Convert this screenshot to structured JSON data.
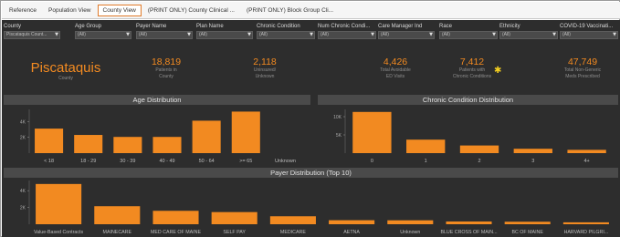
{
  "tabs": [
    {
      "label": "Reference",
      "active": false
    },
    {
      "label": "Population View",
      "active": false
    },
    {
      "label": "County View",
      "active": true
    },
    {
      "label": "(PRINT ONLY) County Clinical ...",
      "active": false
    },
    {
      "label": "(PRINT ONLY) Block Group Cli...",
      "active": false
    }
  ],
  "filters": [
    {
      "label": "County",
      "value": "Piscataquis Count..."
    },
    {
      "label": "Age Group",
      "value": "(All)"
    },
    {
      "label": "Payer Name",
      "value": "(All)"
    },
    {
      "label": "Plan Name",
      "value": "(All)"
    },
    {
      "label": "Chronic Condition",
      "value": "(All)"
    },
    {
      "label": "Num Chronic Condi...",
      "value": "(All)"
    },
    {
      "label": "Care Manager Ind",
      "value": "(All)"
    },
    {
      "label": "Race",
      "value": "(All)"
    },
    {
      "label": "Ethnicity",
      "value": "(All)"
    },
    {
      "label": "COVID-19 Vaccinati...",
      "value": "(All)"
    }
  ],
  "kpis": {
    "county": {
      "value": "Piscataquis",
      "label": "County"
    },
    "patients": {
      "value": "18,819",
      "label1": "Patients in",
      "label2": "County"
    },
    "uninsured": {
      "value": "2,118",
      "label1": "Uninsured/",
      "label2": "Unknown"
    },
    "ed_visits": {
      "value": "4,426",
      "label1": "Total Avoidable",
      "label2": "ED Visits"
    },
    "chronic": {
      "value": "7,412",
      "label1": "Patients with",
      "label2": "Chronic Conditions"
    },
    "meds": {
      "value": "47,749",
      "label1": "Total Non-Generic",
      "label2": "Meds Prescribed"
    }
  },
  "colors": {
    "bar": "#f28a21",
    "background": "#2d2d2d",
    "panel_title": "#4a4a4a",
    "star": "#f5d020"
  },
  "star_icon": "star-icon",
  "panels": {
    "age_title": "Age Distribution",
    "chronic_title": "Chronic Condition Distribution",
    "payer_title": "Payer Distribution (Top 10)"
  },
  "chart_data": [
    {
      "id": "age",
      "type": "bar",
      "title": "Age Distribution",
      "categories": [
        "< 18",
        "18 - 29",
        "30 - 39",
        "40 - 49",
        "50 - 64",
        ">= 65",
        "Unknown"
      ],
      "values": [
        3100,
        2300,
        2050,
        2050,
        4100,
        5250,
        0
      ],
      "yticks": [
        2000,
        4000
      ],
      "ytick_labels": [
        "2K",
        "4K"
      ],
      "ylim": [
        0,
        5300
      ],
      "grid": false
    },
    {
      "id": "chronic",
      "type": "bar",
      "title": "Chronic Condition Distribution",
      "categories": [
        "0",
        "1",
        "2",
        "3",
        "4+"
      ],
      "values": [
        11300,
        3700,
        2100,
        1200,
        900
      ],
      "yticks": [
        5000,
        10000
      ],
      "ytick_labels": [
        "5K",
        "10K"
      ],
      "ylim": [
        0,
        11500
      ],
      "grid": false
    },
    {
      "id": "payer",
      "type": "bar",
      "title": "Payer Distribution (Top 10)",
      "categories": [
        "Value-Based Contracts",
        "MAINECARE",
        "MED CARE OF MAINE",
        "SELF PAY",
        "MEDICARE",
        "AETNA",
        "Unknown",
        "BLUE CROSS OF MAIN...",
        "BC OF MAINE",
        "HARVARD PILGRI..."
      ],
      "values": [
        4800,
        2150,
        1600,
        1450,
        950,
        480,
        470,
        330,
        300,
        230
      ],
      "yticks": [
        2000,
        4000
      ],
      "ytick_labels": [
        "2K",
        "4K"
      ],
      "ylim": [
        0,
        5000
      ],
      "grid": false
    }
  ]
}
